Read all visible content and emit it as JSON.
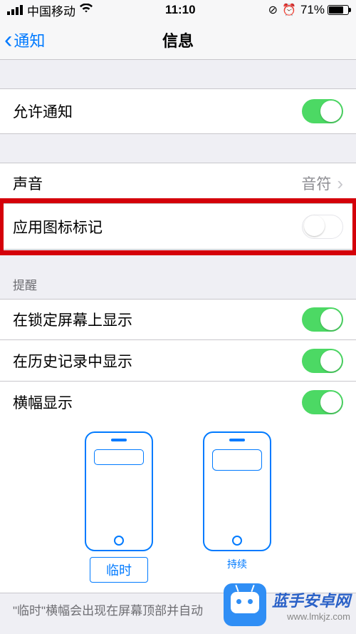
{
  "statusbar": {
    "carrier": "中国移动",
    "time": "11:10",
    "battery_pct": "71%"
  },
  "nav": {
    "back_label": "通知",
    "title": "信息"
  },
  "rows": {
    "allow_notifications": "允许通知",
    "sound_label": "声音",
    "sound_value": "音符",
    "badge_label": "应用图标标记"
  },
  "section_alerts_header": "提醒",
  "alerts": {
    "lock_screen": "在锁定屏幕上显示",
    "history": "在历史记录中显示",
    "banners": "横幅显示"
  },
  "banner_style": {
    "temp": "临时",
    "pers": "持续"
  },
  "footer_text": "\"临时\"横幅会出现在屏幕顶部并自动",
  "watermark": {
    "line1": "蓝手安卓网",
    "line2": "www.lmkjz.com"
  }
}
